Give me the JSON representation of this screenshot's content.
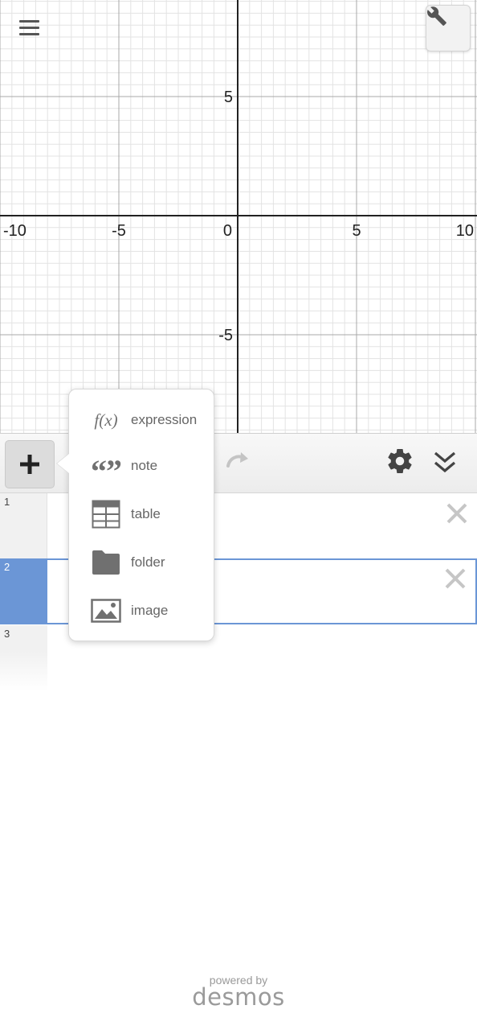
{
  "graph": {
    "x_tick_labels": [
      "-10",
      "-5",
      "0",
      "5",
      "10"
    ],
    "y_tick_labels": [
      "5",
      "-5"
    ],
    "x_range": [
      -10,
      10
    ],
    "y_range": [
      -9,
      9
    ]
  },
  "icons": {
    "menu": "hamburger-menu-icon",
    "graph_settings": "wrench-icon",
    "add": "plus-icon",
    "redo": "redo-icon",
    "settings": "gear-icon",
    "collapse": "double-chevron-down-icon",
    "delete": "close-icon"
  },
  "expressions": [
    {
      "index": "1",
      "selected": false
    },
    {
      "index": "2",
      "selected": true
    },
    {
      "index": "3",
      "selected": false
    }
  ],
  "add_menu": {
    "items": [
      {
        "icon": "fx-icon",
        "icon_text": "f(x)",
        "label": "expression"
      },
      {
        "icon": "quote-icon",
        "icon_text": "“”",
        "label": "note"
      },
      {
        "icon": "table-icon",
        "label": "table"
      },
      {
        "icon": "folder-icon",
        "label": "folder"
      },
      {
        "icon": "image-icon",
        "label": "image"
      }
    ]
  },
  "footer": {
    "powered_by": "powered by",
    "brand": "desmos"
  },
  "colors": {
    "selected_accent": "#6b96d6",
    "axis": "#222222",
    "icon_gray": "#707070"
  }
}
